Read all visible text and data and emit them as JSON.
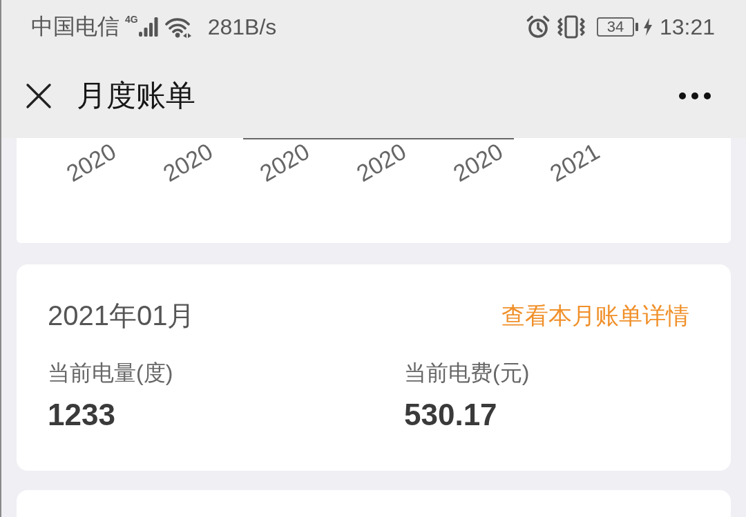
{
  "status_bar": {
    "carrier": "中国电信",
    "network_type": "4G",
    "speed": "281B/s",
    "battery": "34",
    "charging": true,
    "time": "13:21"
  },
  "header": {
    "title": "月度账单"
  },
  "chart": {
    "axis_labels": [
      "2020",
      "2020",
      "2020",
      "2020",
      "2020",
      "2021"
    ]
  },
  "bill": {
    "month": "2021年01月",
    "link": "查看本月账单详情",
    "stats": [
      {
        "label": "当前电量(度)",
        "value": "1233"
      },
      {
        "label": "当前电费(元)",
        "value": "530.17"
      }
    ]
  }
}
